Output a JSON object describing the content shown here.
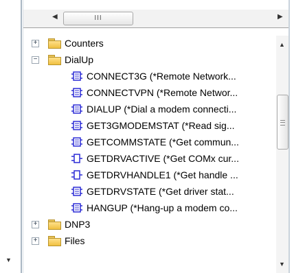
{
  "hscroll": {
    "thumb_grip": "III"
  },
  "tree": {
    "items": [
      {
        "label": "Counters",
        "type": "folder",
        "expander": "+",
        "level": 0
      },
      {
        "label": "DialUp",
        "type": "folder",
        "expander": "−",
        "level": 0
      },
      {
        "label": "CONNECT3G (*Remote Network...",
        "type": "function",
        "icon": "module-icon",
        "level": 1
      },
      {
        "label": "CONNECTVPN (*Remote Networ...",
        "type": "function",
        "icon": "module-icon",
        "level": 1
      },
      {
        "label": "DIALUP (*Dial a modem connecti...",
        "type": "function",
        "icon": "module-icon",
        "level": 1
      },
      {
        "label": "GET3GMODEMSTAT (*Read sig...",
        "type": "function",
        "icon": "module-icon",
        "level": 1
      },
      {
        "label": "GETCOMMSTATE (*Get commun...",
        "type": "function",
        "icon": "module-icon",
        "level": 1
      },
      {
        "label": "GETDRVACTIVE (*Get COMx cur...",
        "type": "function",
        "icon": "block-icon",
        "level": 1
      },
      {
        "label": "GETDRVHANDLE1 (*Get handle ...",
        "type": "function",
        "icon": "block-icon",
        "level": 1
      },
      {
        "label": "GETDRVSTATE (*Get driver stat...",
        "type": "function",
        "icon": "module-icon",
        "level": 1
      },
      {
        "label": "HANGUP (*Hang-up a modem co...",
        "type": "function",
        "icon": "module-icon",
        "level": 1
      },
      {
        "label": "DNP3",
        "type": "folder",
        "expander": "+",
        "level": 0
      },
      {
        "label": "Files",
        "type": "folder",
        "expander": "+",
        "level": 0
      }
    ]
  },
  "colors": {
    "module_icon": "#2b2bd6",
    "block_icon": "#2b2bd6",
    "folder": "#f0c040"
  }
}
